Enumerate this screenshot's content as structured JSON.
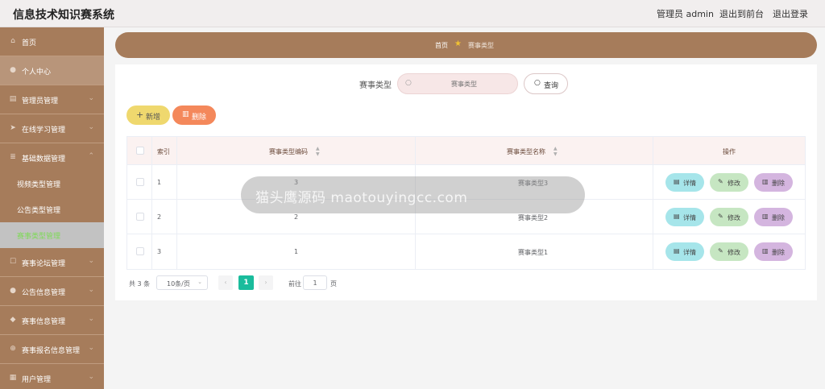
{
  "header": {
    "title": "信息技术知识赛系统",
    "user": "管理员 admin",
    "front": "退出到前台",
    "logout": "退出登录"
  },
  "sidebar": {
    "items": [
      {
        "label": "首页",
        "icon": "home-icon"
      },
      {
        "label": "个人中心",
        "icon": "user-icon"
      },
      {
        "label": "管理员管理",
        "icon": "admin-icon"
      },
      {
        "label": "在线学习管理",
        "icon": "send-icon"
      },
      {
        "label": "基础数据管理",
        "icon": "database-icon"
      },
      {
        "label": "赛事论坛管理",
        "icon": "forum-icon"
      },
      {
        "label": "公告信息管理",
        "icon": "notice-icon"
      },
      {
        "label": "赛事信息管理",
        "icon": "trophy-icon"
      },
      {
        "label": "赛事报名信息管理",
        "icon": "globe-icon"
      },
      {
        "label": "用户管理",
        "icon": "users-icon"
      }
    ],
    "sub_items": [
      {
        "label": "视频类型管理"
      },
      {
        "label": "公告类型管理"
      },
      {
        "label": "赛事类型管理"
      }
    ]
  },
  "breadcrumb": {
    "home": "首页",
    "current": "赛事类型"
  },
  "search": {
    "label": "赛事类型",
    "placeholder": "赛事类型",
    "button": "查询"
  },
  "actions": {
    "add": "新增",
    "delete": "删除"
  },
  "table": {
    "headers": {
      "index": "索引",
      "code": "赛事类型编码",
      "name": "赛事类型名称",
      "ops": "操作"
    },
    "rows": [
      {
        "index": "1",
        "code": "3",
        "name": "赛事类型3"
      },
      {
        "index": "2",
        "code": "2",
        "name": "赛事类型2"
      },
      {
        "index": "3",
        "code": "1",
        "name": "赛事类型1"
      }
    ],
    "ops": {
      "detail": "详情",
      "edit": "修改",
      "delete": "删除"
    }
  },
  "pagination": {
    "total": "共 3 条",
    "page_size": "10条/页",
    "current": "1",
    "goto_label": "前往",
    "goto_value": "1",
    "page_label": "页"
  },
  "watermark": {
    "text": "猫头鹰源码 maotouyingcc.com"
  },
  "colors": {
    "sidebar": "#a67c5b",
    "active_sub": "#7ed957",
    "page_active": "#1abc9c",
    "add_button": "#efd86e",
    "delete_button": "#f4885b",
    "detail_button": "#a6e5ea",
    "edit_button": "#c6e6c2",
    "remove_button": "#d4b5df"
  }
}
